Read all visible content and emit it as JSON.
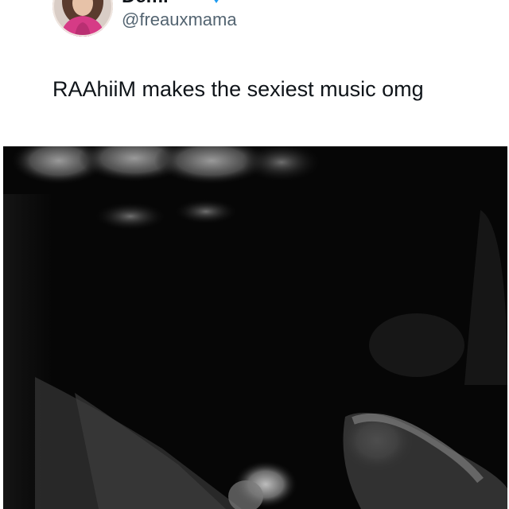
{
  "tweet": {
    "author": {
      "display_name": "Demi",
      "handle": "@freauxmama",
      "avatar_icon": "profile-photo-avatar",
      "badges": [
        "sparkle-emoji-icon",
        "verified-badge-icon"
      ],
      "verified_color": "#1d9bf0"
    },
    "text": "RAAhiiM makes the sexiest music omg",
    "media": {
      "type": "video",
      "description_icon": "video-thumbnail-image"
    }
  },
  "colors": {
    "text_primary": "#0f1419",
    "text_secondary": "#536471",
    "background": "#ffffff",
    "media_background": "#050505"
  }
}
